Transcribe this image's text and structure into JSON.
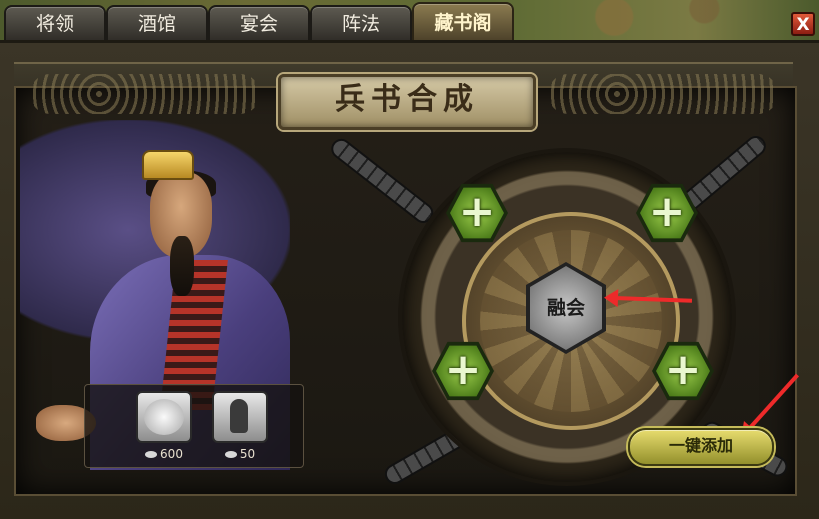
{
  "tabs": [
    {
      "label": "将领"
    },
    {
      "label": "酒馆"
    },
    {
      "label": "宴会"
    },
    {
      "label": "阵法"
    },
    {
      "label": "藏书阁",
      "active": true
    }
  ],
  "close_label": "X",
  "title": "兵书合成",
  "costs": [
    {
      "icon": "scroll-icon",
      "value": "600"
    },
    {
      "icon": "silhouette-icon",
      "value": "50"
    }
  ],
  "merge_label": "融会",
  "quick_add_label": "一键添加",
  "add_slot_glyph": "+",
  "colors": {
    "accent_green": "#9ed04c",
    "arrow_red": "#ee2a2a",
    "title_plate": "#d5c9a6"
  }
}
